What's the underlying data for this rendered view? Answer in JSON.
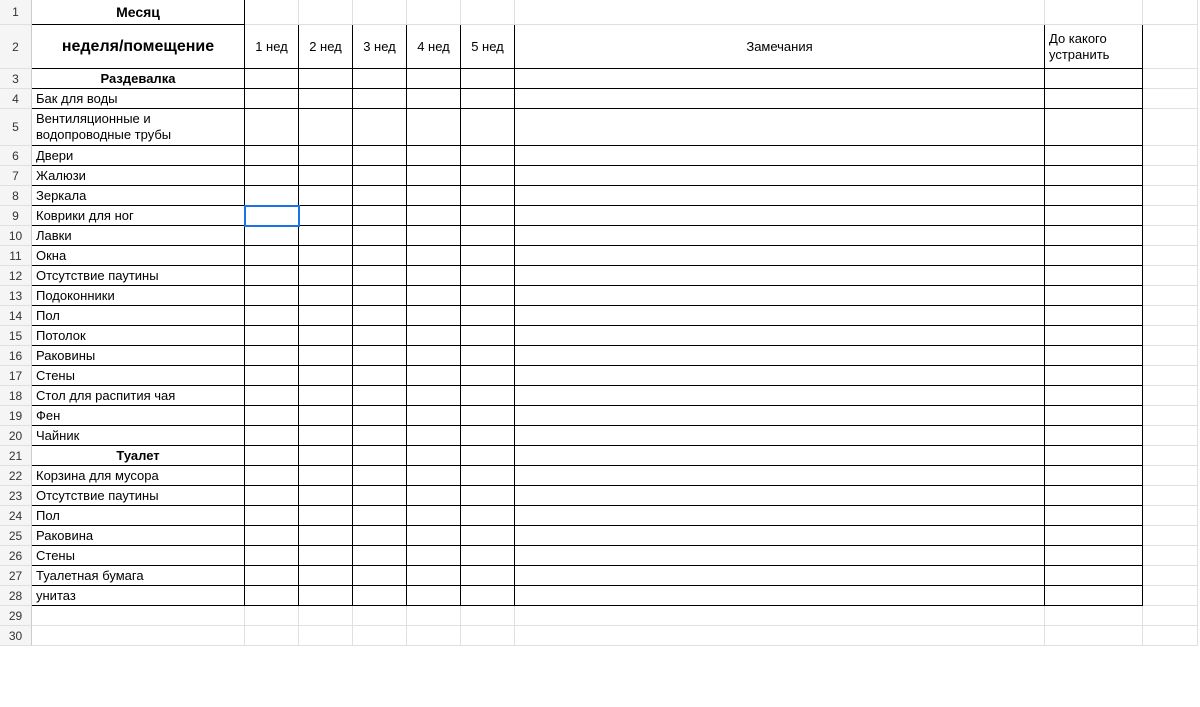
{
  "headers": {
    "month": "Месяц",
    "week_room": "неделя/помещение",
    "week1": "1 нед",
    "week2": "2 нед",
    "week3": "3 нед",
    "week4": "4 нед",
    "week5": "5 нед",
    "notes": "Замечания",
    "deadline": "До какого устранить"
  },
  "sections": {
    "locker": "Раздевалка",
    "toilet": "Туалет"
  },
  "rows": {
    "r4": "Бак для воды",
    "r5": "Вентиляционные и водопроводные трубы",
    "r6": "Двери",
    "r7": "Жалюзи",
    "r8": "Зеркала",
    "r9": "Коврики для ног",
    "r10": "Лавки",
    "r11": "Окна",
    "r12": "Отсутствие паутины",
    "r13": "Подоконники",
    "r14": "Пол",
    "r15": "Потолок",
    "r16": "Раковины",
    "r17": "Стены",
    "r18": "Стол для распития чая",
    "r19": "Фен",
    "r20": "Чайник",
    "r22": "Корзина для мусора",
    "r23": "Отсутствие паутины",
    "r24": "Пол",
    "r25": "Раковина",
    "r26": "Стены",
    "r27": "Туалетная бумага",
    "r28": "унитаз"
  },
  "rownums": [
    "1",
    "2",
    "3",
    "4",
    "5",
    "6",
    "7",
    "8",
    "9",
    "10",
    "11",
    "12",
    "13",
    "14",
    "15",
    "16",
    "17",
    "18",
    "19",
    "20",
    "21",
    "22",
    "23",
    "24",
    "25",
    "26",
    "27",
    "28",
    "29",
    "30"
  ],
  "selected_cell": "B9"
}
